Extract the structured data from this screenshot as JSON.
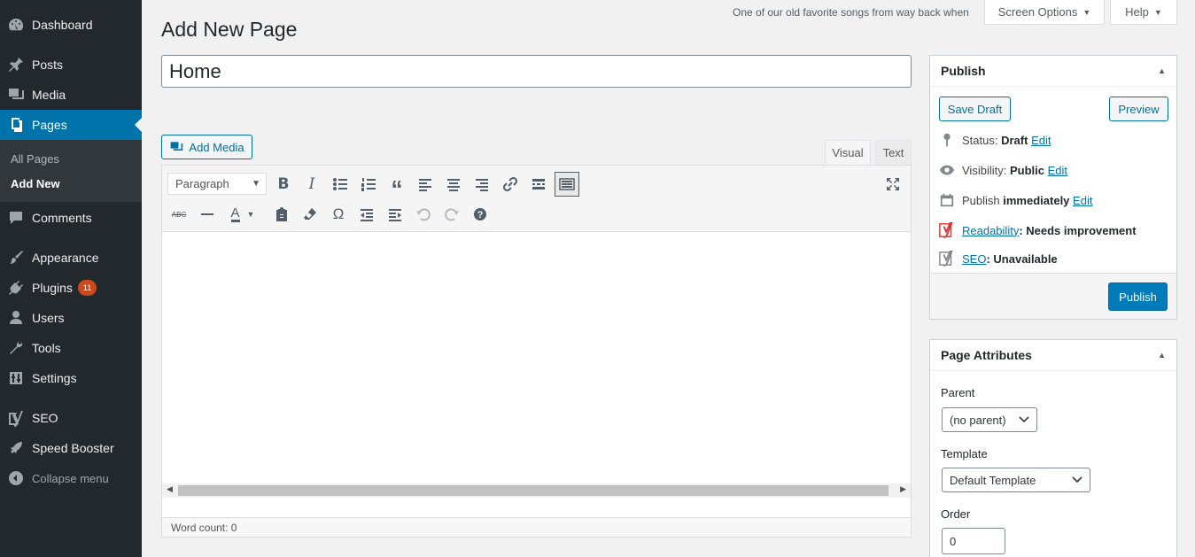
{
  "sidebar": {
    "items": [
      {
        "label": "Dashboard",
        "icon": "dashboard-icon"
      },
      {
        "label": "Posts",
        "icon": "pin-icon"
      },
      {
        "label": "Media",
        "icon": "media-icon"
      },
      {
        "label": "Pages",
        "icon": "pages-icon"
      },
      {
        "label": "Comments",
        "icon": "comments-icon"
      },
      {
        "label": "Appearance",
        "icon": "brush-icon"
      },
      {
        "label": "Plugins",
        "icon": "plugin-icon",
        "badge": "11"
      },
      {
        "label": "Users",
        "icon": "users-icon"
      },
      {
        "label": "Tools",
        "icon": "wrench-icon"
      },
      {
        "label": "Settings",
        "icon": "settings-icon"
      },
      {
        "label": "SEO",
        "icon": "yoast-icon"
      },
      {
        "label": "Speed Booster",
        "icon": "rocket-icon"
      },
      {
        "label": "Collapse menu",
        "icon": "collapse-icon"
      }
    ],
    "submenu": [
      "All Pages",
      "Add New"
    ]
  },
  "header": {
    "song": "One of our old favorite songs from way back when",
    "screen_options": "Screen Options",
    "help": "Help",
    "page_title": "Add New Page"
  },
  "editor": {
    "title_value": "Home",
    "add_media": "Add Media",
    "tab_visual": "Visual",
    "tab_text": "Text",
    "format": "Paragraph",
    "word_count": "Word count: 0"
  },
  "publish": {
    "title": "Publish",
    "save_draft": "Save Draft",
    "preview": "Preview",
    "status_label": "Status:",
    "status_value": "Draft",
    "visibility_label": "Visibility:",
    "visibility_value": "Public",
    "publish_label": "Publish",
    "publish_value": "immediately",
    "edit": "Edit",
    "readability_link": "Readability",
    "readability_value": ": Needs improvement",
    "seo_link": "SEO",
    "seo_value": ": Unavailable",
    "publish_button": "Publish"
  },
  "attributes": {
    "title": "Page Attributes",
    "parent_label": "Parent",
    "parent_value": "(no parent)",
    "template_label": "Template",
    "template_value": "Default Template",
    "order_label": "Order",
    "order_value": "0"
  },
  "colors": {
    "sidebar_bg": "#23282d",
    "accent": "#0073aa",
    "badge": "#ca4a1f",
    "yoast_red": "#dc3232"
  }
}
